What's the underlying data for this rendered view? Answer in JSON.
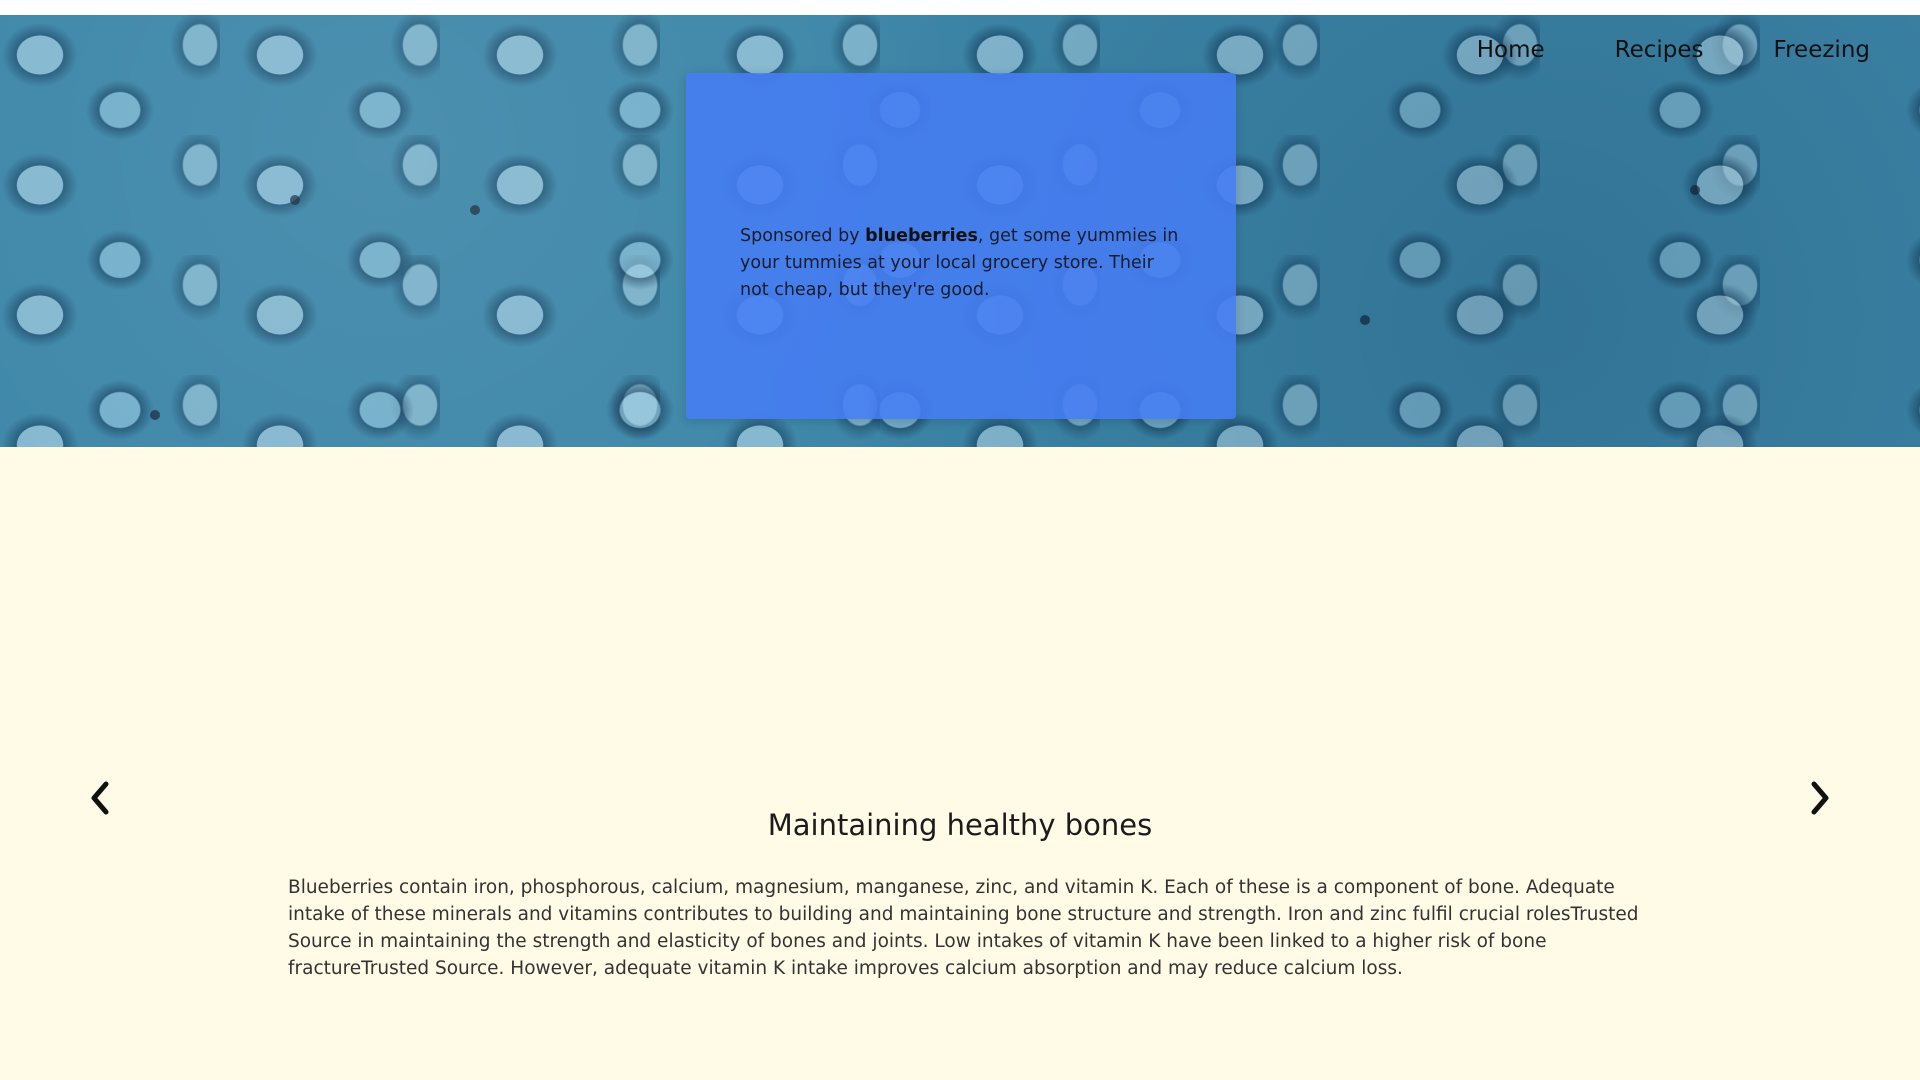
{
  "nav": {
    "items": [
      {
        "label": "Home"
      },
      {
        "label": "Recipes"
      },
      {
        "label": "Freezing"
      }
    ]
  },
  "promo": {
    "prefix": "Sponsored by ",
    "brand": "blueberries",
    "suffix": ", get some yummies in your tummies at your local grocery store. Their not cheap, but they're good."
  },
  "slide": {
    "title": "Maintaining healthy bones",
    "body": "Blueberries contain iron, phosphorous, calcium, magnesium, manganese, zinc, and vitamin K. Each of these is a component of bone. Adequate intake of these minerals and vitamins contributes to building and maintaining bone structure and strength. Iron and zinc fulfil crucial rolesTrusted Source in maintaining the strength and elasticity of bones and joints. Low intakes of vitamin K have been linked to a higher risk of bone fractureTrusted Source. However, adequate vitamin K intake improves calcium absorption and may reduce calcium loss."
  },
  "icons": {
    "prev": "chevron-left-icon",
    "next": "chevron-right-icon"
  },
  "colors": {
    "background": "#fffbe6",
    "promo_card": "#467df5",
    "hero": "#3d86a8"
  }
}
